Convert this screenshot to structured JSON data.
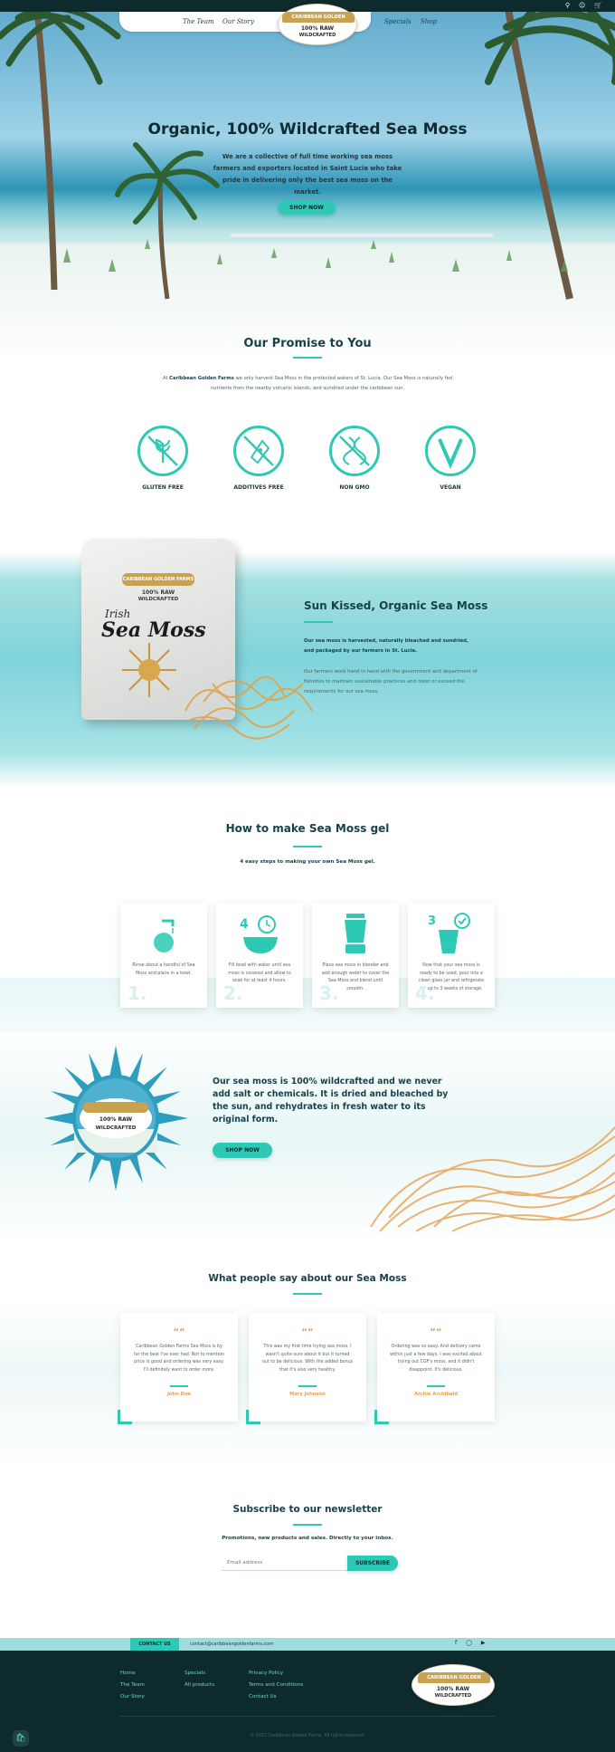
{
  "nav": {
    "links_left": [
      "The Team",
      "Our Story"
    ],
    "links_right": [
      "Specials",
      "Shop"
    ],
    "logo_top": "CARIBBEAN GOLDEN FARMS",
    "logo_l1": "100% RAW",
    "logo_l2": "WILDCRAFTED",
    "icons": [
      "search-icon",
      "user-icon",
      "cart-icon"
    ]
  },
  "hero": {
    "title": "Organic, 100% Wildcrafted Sea Moss",
    "subtitle": "We are a collective of full time working sea moss farmers and exporters located in Saint Lucia who take pride in delivering only the best sea moss on the market.",
    "button": "SHOP NOW"
  },
  "promise": {
    "title": "Our Promise to You",
    "text_prefix": "At ",
    "brand": "Caribbean Golden Farms",
    "text_suffix": " we only harvest Sea Moss in the protected waters of St. Lucia. Our Sea Moss is naturally fed nutrients from the nearby volcanic islands, and sundried under the caribbean sun.",
    "badges": [
      "GLUTEN FREE",
      "ADDITIVES FREE",
      "NON GMO",
      "VEGAN"
    ]
  },
  "product": {
    "pack_top": "CARIBBEAN GOLDEN FARMS",
    "pack_l1": "100% RAW",
    "pack_l2": "WILDCRAFTED",
    "pack_title1": "Irish",
    "pack_title2": "Sea Moss",
    "title": "Sun Kissed, Organic Sea Moss",
    "bold_text": "Our sea moss is harvested, naturally bleached and sundried, and packaged by our farmers in St. Lucia.",
    "text": "Our farmers work hand in hand with the government and department of fisheries to maintain sustainable practices and meet or exceed the requirements for our sea moss."
  },
  "howto": {
    "title": "How to make Sea Moss gel",
    "subtitle": "4 easy steps to making your own Sea Moss gel.",
    "steps": [
      {
        "num": "1.",
        "text": "Rinse about a handful of Sea Moss and place in a bowl."
      },
      {
        "num": "2.",
        "text": "Fill bowl with water until sea moss is covered and allow to soak for at least 4 hours."
      },
      {
        "num": "3.",
        "text": "Place sea moss in blender and add enough water to cover the Sea Moss and blend until smooth."
      },
      {
        "num": "4.",
        "text": "Now that your sea moss is ready to be used, pour into a clean glass jar and refrigerate for up to 3 weeks of storage."
      }
    ]
  },
  "wild": {
    "text": "Our sea moss is 100% wildcrafted and we never add salt or chemicals. It is dried and bleached by the sun, and rehydrates in fresh water to its original form.",
    "button": "SHOP NOW"
  },
  "testimonials": {
    "title": "What people say about our Sea Moss",
    "items": [
      {
        "text": "Caribbean Golden Farms Sea Moss is by far the best I've ever had. Not to mention price is good and ordering was very easy. I'll definitely want to order more.",
        "name": "John Doe"
      },
      {
        "text": "This was my first time trying sea moss. I wasn't quite sure about it but it turned out to be delicious. With the added bonus that it's also very healthy.",
        "name": "Mary Johnson"
      },
      {
        "text": "Ordering was so easy. And delivery came within just a few days. I was excited about trying out CGF's moss, and it didn't disappoint. It's delicious.",
        "name": "Archie Archibald"
      }
    ]
  },
  "newsletter": {
    "title": "Subscribe to our newsletter",
    "subtitle": "Promotions, new products and sales. Directly to your inbox.",
    "placeholder": "Email address",
    "button": "SUBSCRIBE"
  },
  "footer": {
    "contact_label": "CONTACT US",
    "email": "contact@caribbeangoldenfarms.com",
    "col1": [
      "Home",
      "The Team",
      "Our Story"
    ],
    "col2": [
      "Specials",
      "All products"
    ],
    "col3": [
      "Privacy Policy",
      "Terms and Conditions",
      "Contact Us"
    ],
    "copyright": "© 2022 Caribbean Golden Farms. All rights reserved."
  },
  "colors": {
    "accent": "#2ec9b4",
    "dark": "#0d2a2d",
    "gold": "#c8a24f",
    "orange": "#e3a34c"
  }
}
